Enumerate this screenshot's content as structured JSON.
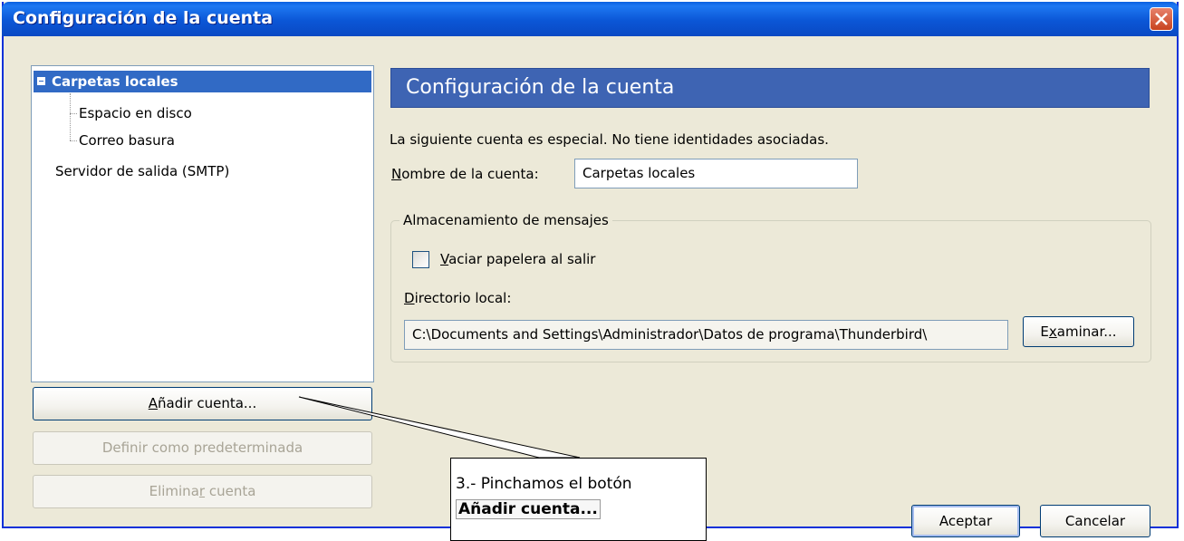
{
  "window": {
    "title": "Configuración de la cuenta"
  },
  "tree": {
    "items": [
      {
        "label": "Carpetas locales"
      },
      {
        "label": "Espacio en disco"
      },
      {
        "label": "Correo basura"
      },
      {
        "label": "Servidor de salida (SMTP)"
      }
    ]
  },
  "left_buttons": {
    "add_account": {
      "pre": "",
      "access": "A",
      "post": "ñadir cuenta..."
    },
    "set_default": {
      "pre": "Def",
      "access": "i",
      "post": "nir como predeterminada"
    },
    "delete_account": {
      "pre": "Elimina",
      "access": "r",
      "post": " cuenta"
    }
  },
  "panel": {
    "header": "Configuración de la cuenta",
    "description": "La siguiente cuenta es especial. No tiene identidades asociadas.",
    "account_name": {
      "label_access": "N",
      "label_rest": "ombre de la cuenta:",
      "value": "Carpetas locales"
    },
    "storage": {
      "title": "Almacenamiento de mensajes",
      "empty_trash": {
        "access": "V",
        "rest": "aciar papelera al salir",
        "checked": false
      },
      "local_dir": {
        "label_access": "D",
        "label_rest": "irectorio local:",
        "value": "C:\\Documents and Settings\\Administrador\\Datos de programa\\Thunderbird\\"
      },
      "browse": {
        "pre": "E",
        "access": "x",
        "post": "aminar..."
      }
    }
  },
  "dialog_buttons": {
    "accept": "Aceptar",
    "cancel": "Cancelar"
  },
  "callout": {
    "line1": "3.- Pinchamos el botón",
    "line2": "Añadir cuenta..."
  },
  "colors": {
    "titlebar": "#0a5fe0",
    "selection": "#316ac5",
    "header_bar": "#3e64b3",
    "window_bg": "#ece9d8"
  }
}
